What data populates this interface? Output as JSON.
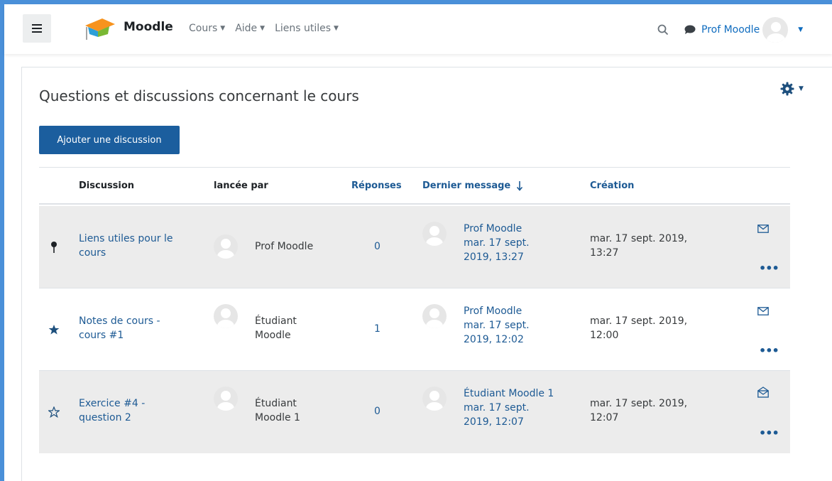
{
  "header": {
    "brand": "Moodle",
    "menu": [
      {
        "label": "Cours"
      },
      {
        "label": "Aide"
      },
      {
        "label": "Liens utiles"
      }
    ],
    "user_name": "Prof Moodle"
  },
  "page": {
    "title": "Questions et discussions concernant le cours",
    "add_button": "Ajouter une discussion"
  },
  "table": {
    "headers": {
      "discussion": "Discussion",
      "started_by": "lancée par",
      "replies": "Réponses",
      "last_post": "Dernier message",
      "created": "Création"
    },
    "rows": [
      {
        "status_icon": "pin-icon",
        "title_line1": "Liens utiles pour le",
        "title_line2": "cours",
        "author_line1": "Prof Moodle",
        "author_line2": "",
        "replies": "0",
        "last_author": "Prof Moodle",
        "last_date_line1": "mar. 17 sept.",
        "last_date_line2": "2019, 13:27",
        "created_line1": "mar. 17 sept. 2019,",
        "created_line2": "13:27",
        "mail_icon": "envelope-icon"
      },
      {
        "status_icon": "star-filled-icon",
        "title_line1": "Notes de cours -",
        "title_line2": "cours #1",
        "author_line1": "Étudiant",
        "author_line2": "Moodle",
        "replies": "1",
        "last_author": "Prof Moodle",
        "last_date_line1": "mar. 17 sept.",
        "last_date_line2": "2019, 12:02",
        "created_line1": "mar. 17 sept. 2019,",
        "created_line2": "12:00",
        "mail_icon": "envelope-icon"
      },
      {
        "status_icon": "star-outline-icon",
        "title_line1": "Exercice #4 -",
        "title_line2": "question 2",
        "author_line1": "Étudiant",
        "author_line2": "Moodle 1",
        "replies": "0",
        "last_author": "Étudiant Moodle 1",
        "last_date_line1": "mar. 17 sept.",
        "last_date_line2": "2019, 12:07",
        "created_line1": "mar. 17 sept. 2019,",
        "created_line2": "12:07",
        "mail_icon": "envelope-open-icon"
      }
    ]
  },
  "colors": {
    "link": "#1d5a94",
    "button": "#1b5e9e",
    "row_grey": "#ececec",
    "frame": "#4a90d9"
  }
}
